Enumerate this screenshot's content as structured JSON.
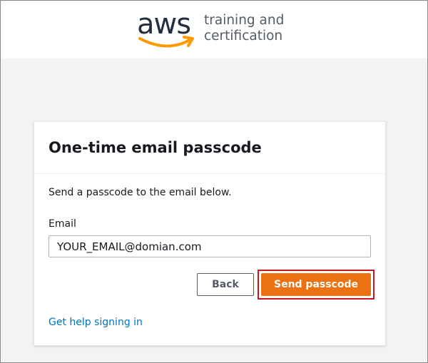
{
  "header": {
    "logo_text": "aws",
    "logo_tagline_line1": "training and",
    "logo_tagline_line2": "certification"
  },
  "card": {
    "title": "One-time email passcode",
    "intro": "Send a passcode to the email below.",
    "email_label": "Email",
    "email_value": "YOUR_EMAIL@domian.com",
    "back_label": "Back",
    "send_label": "Send passcode",
    "help_link": "Get help signing in"
  },
  "colors": {
    "accent": "#ec7211",
    "highlight_border": "#c7161e",
    "link": "#0073bb"
  }
}
